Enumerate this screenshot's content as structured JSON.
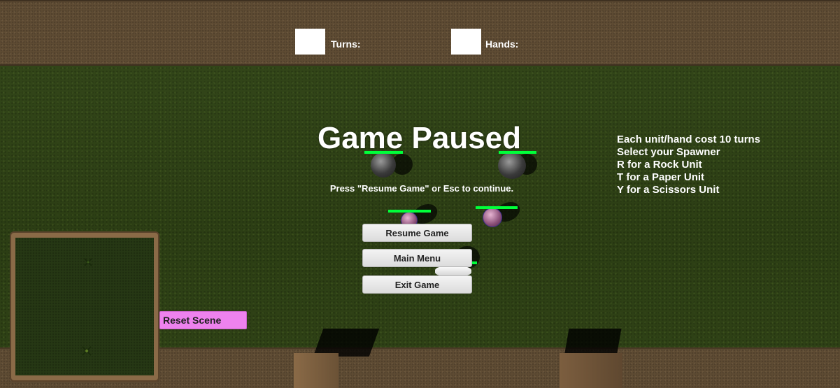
{
  "hud": {
    "turns_label": "Turns:",
    "hands_label": "Hands:"
  },
  "pause_menu": {
    "title": "Game Paused",
    "hint": "Press \"Resume Game\" or Esc to continue.",
    "resume_label": "Resume Game",
    "main_menu_label": "Main Menu",
    "exit_label": "Exit Game"
  },
  "instructions": [
    "Each unit/hand cost 10 turns",
    "Select your Spawner",
    "R for a Rock Unit",
    "T for a Paper Unit",
    "Y for a Scissors Unit"
  ],
  "reset_scene_label": "Reset Scene",
  "colors": {
    "grass": "#2f4117",
    "wall": "#5e4b33",
    "health_bar": "#00ff3a",
    "reset_button": "#ee82ee"
  }
}
